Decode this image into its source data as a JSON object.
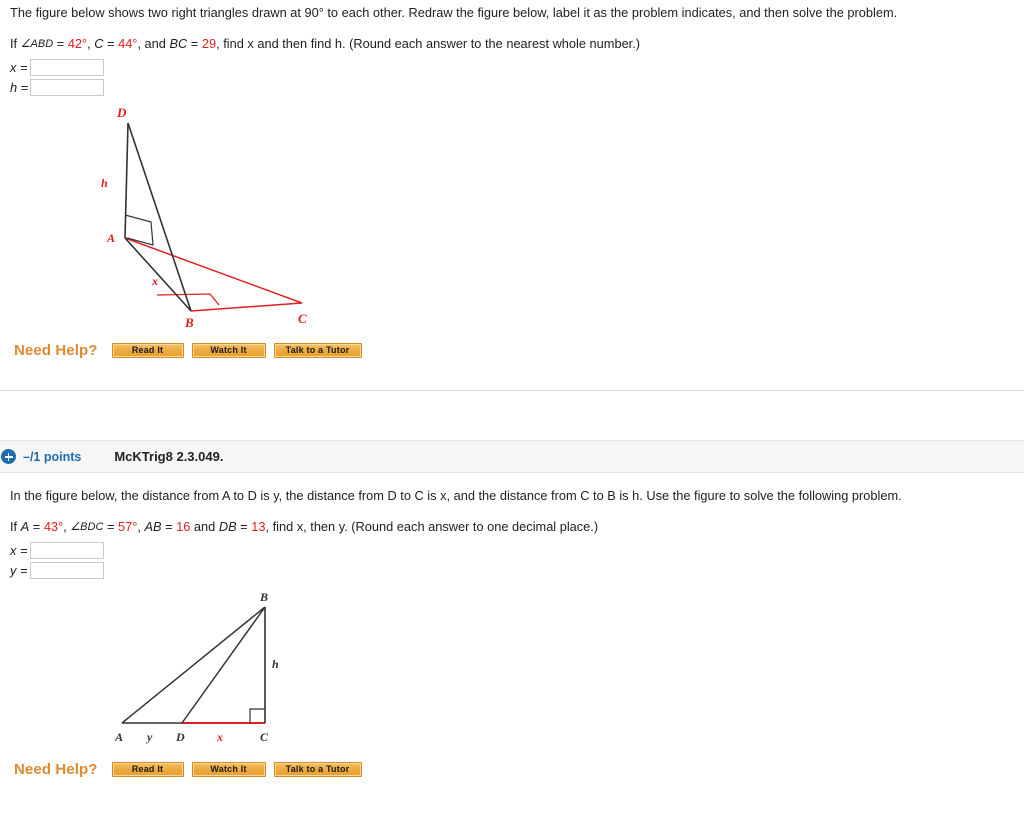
{
  "colors": {
    "red": "#e02020",
    "dark": "#333333",
    "accent_orange": "#e08a30",
    "link_blue": "#1f6bb0"
  },
  "problem1": {
    "intro": "The figure below shows two right triangles drawn at 90° to each other. Redraw the figure below, label it as the problem indicates, and then solve the problem.",
    "given": {
      "prefix": "If ",
      "angle_abd_label": "∠ABD",
      "eq1": " = ",
      "angle_abd_value": "42°",
      "sep1": ", ",
      "c_label": "C",
      "eq2": " = ",
      "c_value": "44°",
      "sep2": ", and ",
      "bc_label": "BC",
      "eq3": " = ",
      "bc_value": "29",
      "tail": ", find x and then find h. (Round each answer to the nearest whole number.)"
    },
    "answers": [
      {
        "label": "x =",
        "value": "",
        "placeholder": ""
      },
      {
        "label": "h =",
        "value": "",
        "placeholder": ""
      }
    ],
    "figure": {
      "type": "two-right-triangles-3d",
      "vertices": {
        "D": "D",
        "A": "A",
        "B": "B",
        "C": "C"
      },
      "edge_labels": {
        "h": "h",
        "x": "x"
      }
    },
    "need_help": {
      "label": "Need Help?",
      "buttons": [
        "Read It",
        "Watch It",
        "Talk to a Tutor"
      ]
    }
  },
  "problem2": {
    "header": {
      "points": "–/1 points",
      "id": "McKTrig8 2.3.049.",
      "expand_icon": "plus-circle-icon"
    },
    "intro": "In the figure below, the distance from A to D is y, the distance from D to C is x, and the distance from C to B is h. Use the figure to solve the following problem.",
    "given": {
      "prefix": "If ",
      "a_label": "A",
      "eq1": " = ",
      "a_value": "43°",
      "sep1": ", ",
      "angle_bdc_label": "∠BDC",
      "eq2": " = ",
      "angle_bdc_value": "57°",
      "sep2": ", ",
      "ab_label": "AB",
      "eq3": " = ",
      "ab_value": "16",
      "sep3": " and ",
      "db_label": "DB",
      "eq4": " = ",
      "db_value": "13",
      "tail": ", find x, then y. (Round each answer to one decimal place.)"
    },
    "answers": [
      {
        "label": "x =",
        "value": "",
        "placeholder": ""
      },
      {
        "label": "y =",
        "value": "",
        "placeholder": ""
      }
    ],
    "figure": {
      "type": "right-triangle-with-cevian",
      "vertices": {
        "A": "A",
        "D": "D",
        "C": "C",
        "B": "B"
      },
      "edge_labels": {
        "y": "y",
        "x": "x",
        "h": "h"
      }
    },
    "need_help": {
      "label": "Need Help?",
      "buttons": [
        "Read It",
        "Watch It",
        "Talk to a Tutor"
      ]
    }
  }
}
